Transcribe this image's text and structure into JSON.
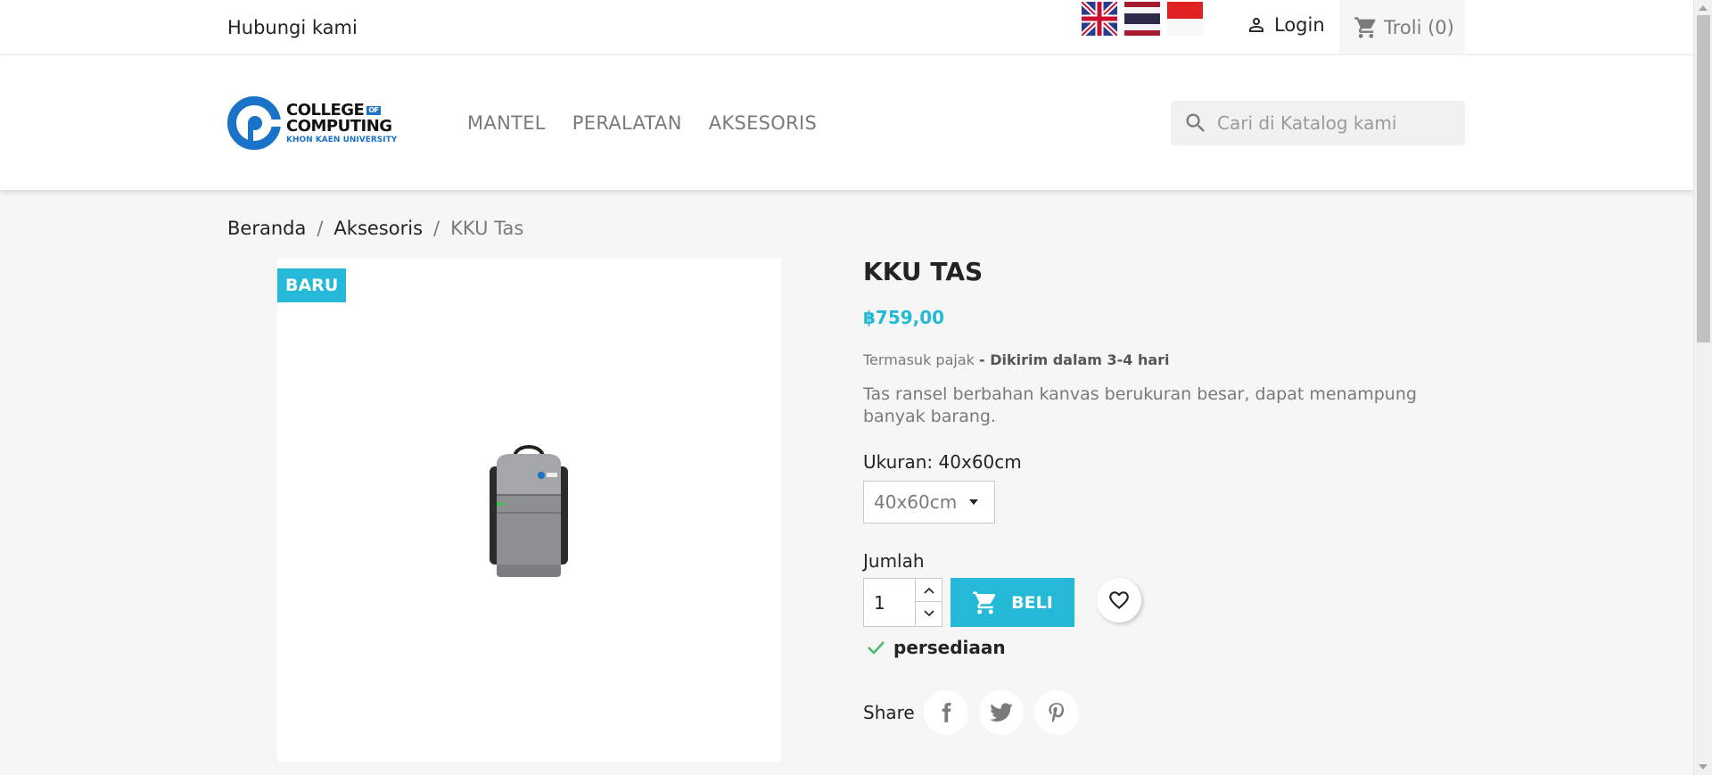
{
  "topbar": {
    "contact": "Hubungi kami",
    "flags": [
      "flag-uk-icon",
      "flag-thailand-icon",
      "flag-indonesia-icon"
    ],
    "login": "Login",
    "cart": "Troli (0)"
  },
  "header": {
    "logo": {
      "line1": "COLLEGE",
      "of": "OF",
      "line2": "COMPUTING",
      "line3": "KHON KAEN UNIVERSITY"
    },
    "nav": [
      "MANTEL",
      "PERALATAN",
      "AKSESORIS"
    ],
    "search_placeholder": "Cari di Katalog kami"
  },
  "breadcrumb": {
    "home": "Beranda",
    "category": "Aksesoris",
    "current": "KKU Tas",
    "sep": "/"
  },
  "product": {
    "badge": "BARU",
    "title": "KKU TAS",
    "price": "฿759,00",
    "tax": "Termasuk pajak",
    "delivery": "- Dikirim dalam 3-4 hari",
    "description": "Tas ransel berbahan kanvas berukuran besar, dapat menampung banyak barang.",
    "size_label": "Ukuran: 40x60cm",
    "size_value": "40x60cm",
    "qty_label": "Jumlah",
    "qty_value": "1",
    "buy_label": "BELI",
    "stock": "persediaan",
    "share_label": "Share"
  },
  "colors": {
    "accent": "#24b9d7",
    "brand_blue": "#1a73c8",
    "stock_green": "#4cbb6c"
  }
}
